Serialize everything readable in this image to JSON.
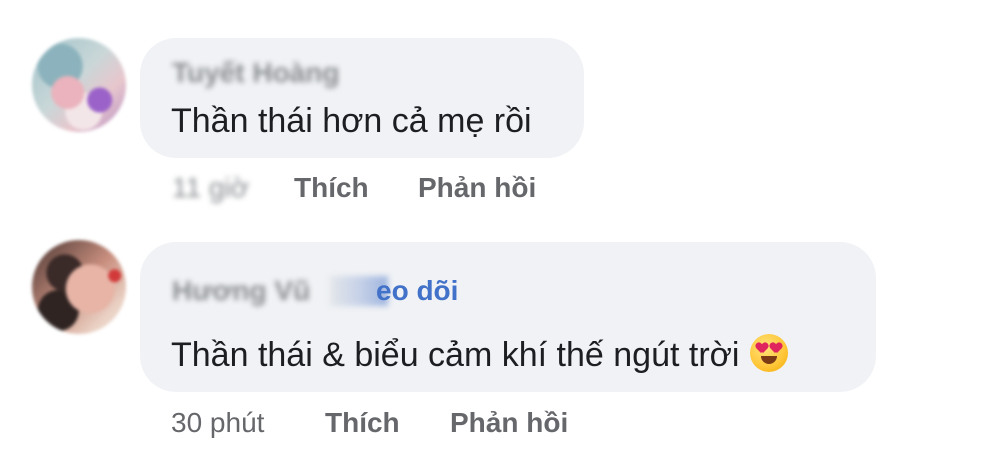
{
  "comments": [
    {
      "author": "Tuyết Hoàng",
      "text": "Thần thái hơn cả mẹ rồi",
      "time": "11 giờ",
      "like_label": "Thích",
      "reply_label": "Phản hồi"
    },
    {
      "author": "Hương Vũ",
      "follow_label": "eo dõi",
      "text": "Thần thái & biểu cảm khí thế ngút trời",
      "emoji": "smiling-face-with-heart-eyes-icon",
      "time": "30 phút",
      "like_label": "Thích",
      "reply_label": "Phản hồi"
    }
  ],
  "colors": {
    "bubble_bg": "#f0f2f5",
    "text": "#1c1e21",
    "meta": "#65676b",
    "link": "#4171c8"
  }
}
